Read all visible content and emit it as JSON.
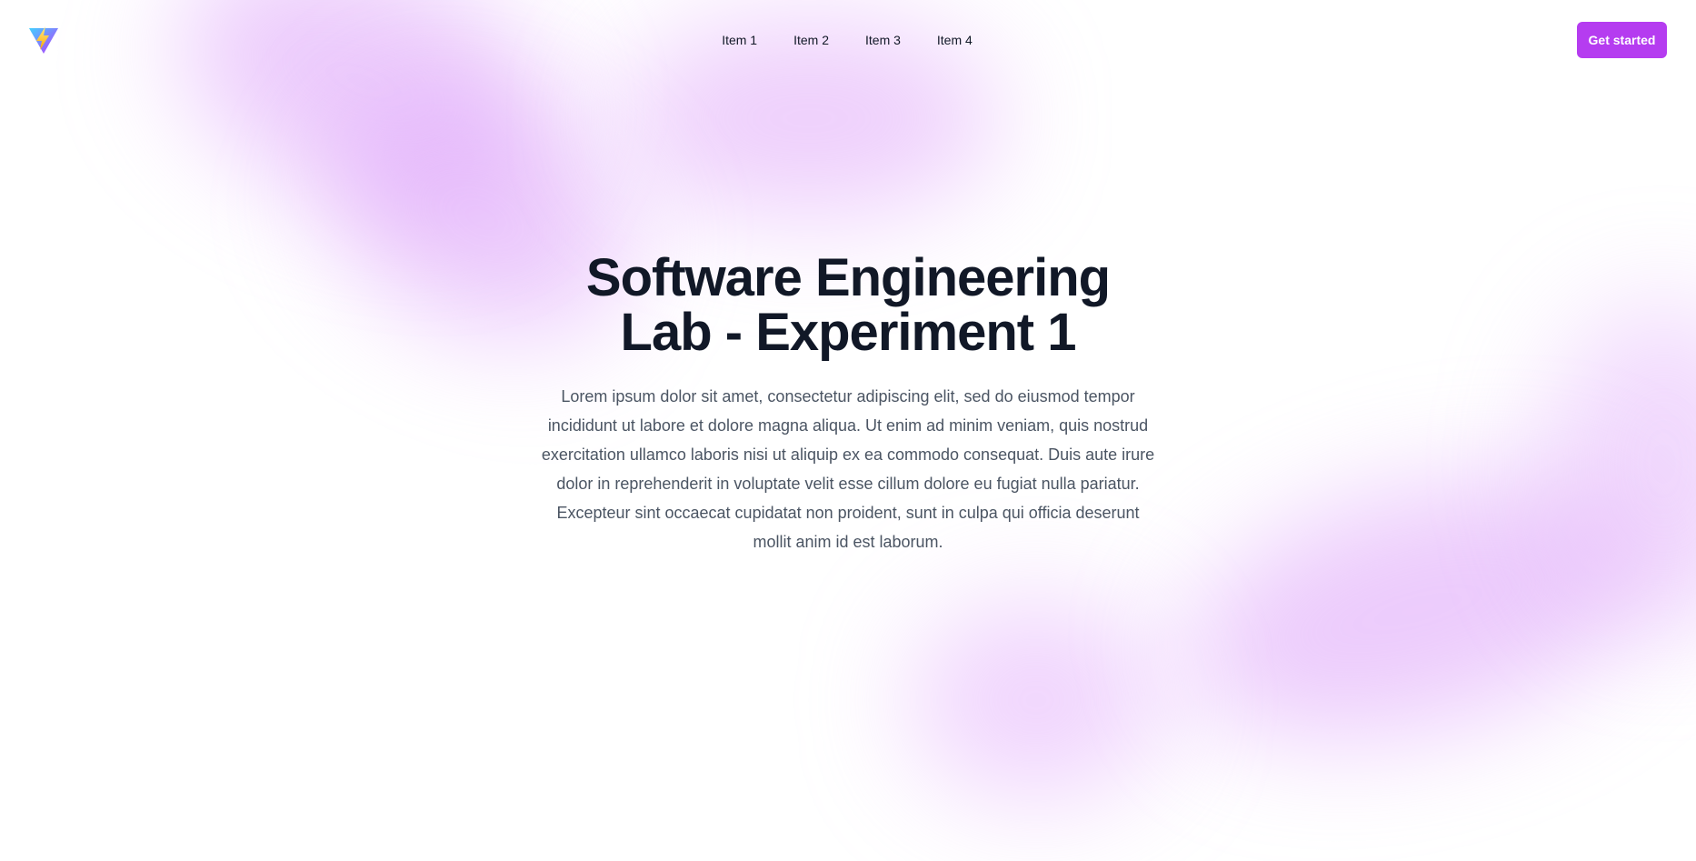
{
  "nav": {
    "items": [
      {
        "label": "Item 1"
      },
      {
        "label": "Item 2"
      },
      {
        "label": "Item 3"
      },
      {
        "label": "Item 4"
      }
    ],
    "cta_label": "Get started"
  },
  "hero": {
    "title_line1": "Software Engineering",
    "title_line2": "Lab - Experiment 1",
    "description": "Lorem ipsum dolor sit amet, consectetur adipiscing elit, sed do eiusmod tempor incididunt ut labore et dolore magna aliqua. Ut enim ad minim veniam, quis nostrud exercitation ullamco laboris nisi ut aliquip ex ea commodo consequat. Duis aute irure dolor in reprehenderit in voluptate velit esse cillum dolore eu fugiat nulla pariatur. Excepteur sint occaecat cupidatat non proident, sunt in culpa qui officia deserunt mollit anim id est laborum."
  },
  "colors": {
    "accent": "#b53cf0",
    "heading": "#111827",
    "body_text": "#4b5563",
    "blob": "#dda0fa"
  },
  "icons": {
    "logo": "vite-logo-icon"
  }
}
